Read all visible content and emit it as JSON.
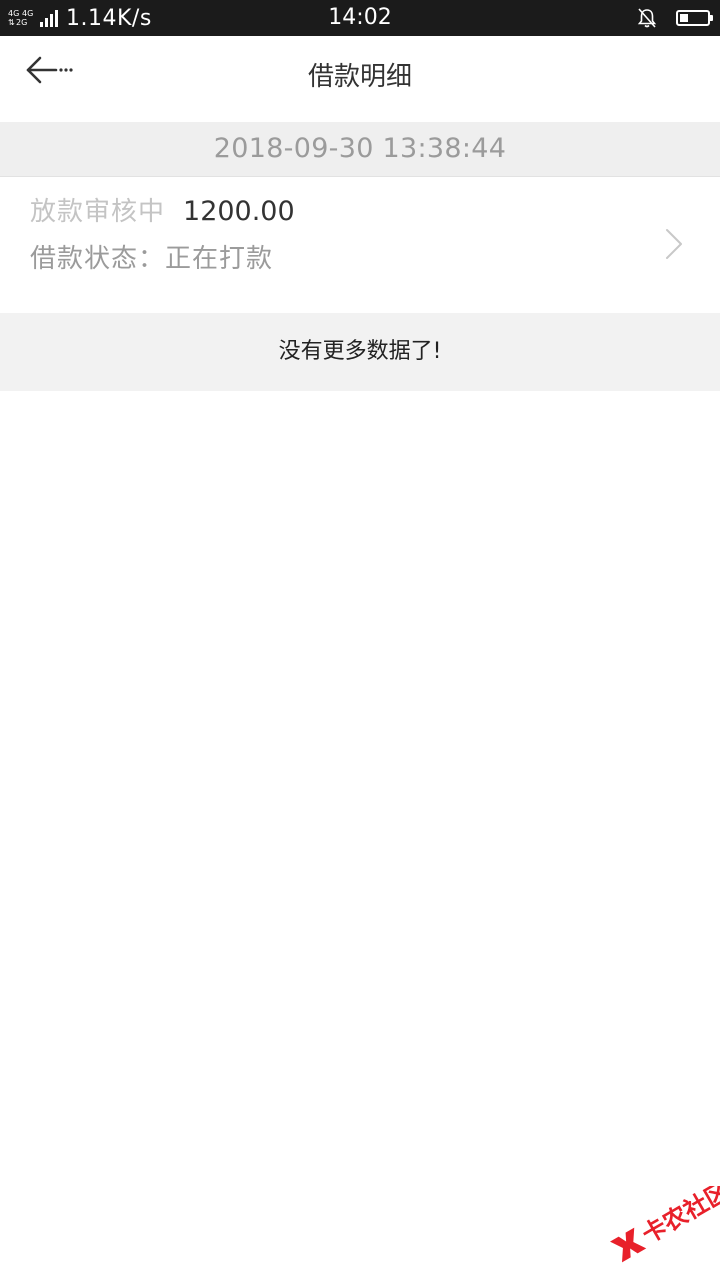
{
  "status_bar": {
    "network_top": [
      "4G",
      "4G"
    ],
    "network_bottom": [
      "2G"
    ],
    "net_speed": "1.14K/s",
    "time": "14:02",
    "battery_level": 0.3,
    "icons": {
      "bell": "bell-muted-icon",
      "battery": "battery-icon"
    }
  },
  "nav": {
    "title": "借款明细",
    "back_icon": "back-arrow-icon"
  },
  "record": {
    "datetime": "2018-09-30 13:38:44",
    "status_label": "放款审核中",
    "amount": "1200.00",
    "state_label": "借款状态：",
    "state_value": "正在打款",
    "chevron_icon": "chevron-right-icon"
  },
  "footer": {
    "no_more": "没有更多数据了!"
  },
  "watermark": {
    "text": "卡农社区"
  },
  "colors": {
    "status_bar_bg": "#1b1b1b",
    "date_header_bg": "#efefef",
    "footer_bg": "#f2f2f2",
    "watermark_red": "#e8202a"
  }
}
